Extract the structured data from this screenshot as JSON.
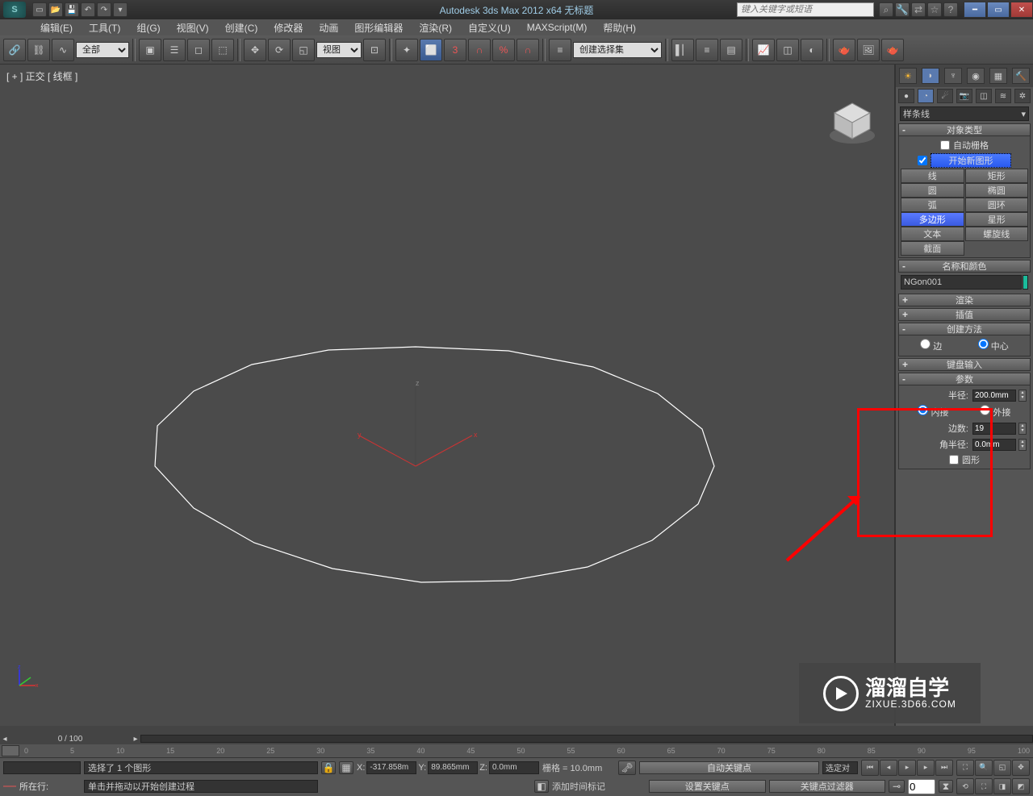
{
  "title": "Autodesk 3ds Max  2012 x64    无标题",
  "search_placeholder": "键入关键字或短语",
  "menu": [
    "编辑(E)",
    "工具(T)",
    "组(G)",
    "视图(V)",
    "创建(C)",
    "修改器",
    "动画",
    "图形编辑器",
    "渲染(R)",
    "自定义(U)",
    "MAXScript(M)",
    "帮助(H)"
  ],
  "toolbar": {
    "filter_all": "全部",
    "view_combo": "视图"
  },
  "viewport": {
    "label": "[ + ] 正交 [ 线框 ]"
  },
  "create_set": "创建选择集",
  "cmd": {
    "spline_drop": "样条线",
    "rollout_objtype": "对象类型",
    "auto_grid": "自动栅格",
    "start_new_shape": "开始新图形",
    "buttons": {
      "line": "线",
      "rect": "矩形",
      "circle": "圆",
      "ellipse": "椭圆",
      "arc": "弧",
      "donut": "圆环",
      "ngon": "多边形",
      "star": "星形",
      "text": "文本",
      "helix": "螺旋线",
      "section": "截面"
    },
    "rollout_namecolor": "名称和颜色",
    "object_name": "NGon001",
    "rollout_render": "渲染",
    "rollout_interp": "插值",
    "rollout_method": "创建方法",
    "method_edge": "边",
    "method_center": "中心",
    "rollout_kbd": "键盘输入",
    "rollout_params": "参数",
    "radius_label": "半径:",
    "radius_val": "200.0mm",
    "inscribed": "内接",
    "circumscribed": "外接",
    "sides_label": "边数:",
    "sides_val": "19",
    "corner_label": "角半径:",
    "corner_val": "0.0mm",
    "circular": "圆形"
  },
  "status": {
    "frame": "0 / 100",
    "ticks": [
      "0",
      "5",
      "10",
      "15",
      "20",
      "25",
      "30",
      "35",
      "40",
      "45",
      "50",
      "55",
      "60",
      "65",
      "70",
      "75",
      "80",
      "85",
      "90",
      "95",
      "100"
    ],
    "sel": "选择了 1 个图形",
    "prompt": "单击并拖动以开始创建过程",
    "x_label": "X:",
    "x": "-317.858m",
    "y_label": "Y:",
    "y": "89.865mm",
    "z_label": "Z:",
    "z": "0.0mm",
    "grid_label": "栅格 = 10.0mm",
    "add_time_tag": "添加时间标记",
    "auto_key": "自动关键点",
    "sel_only": "选定对",
    "set_key": "设置关键点",
    "key_filter": "关键点过滤器",
    "now_at": "所在行:",
    "frame_input": "0"
  },
  "watermark": {
    "brand": "溜溜自学",
    "site": "ZIXUE.3D66.COM"
  }
}
